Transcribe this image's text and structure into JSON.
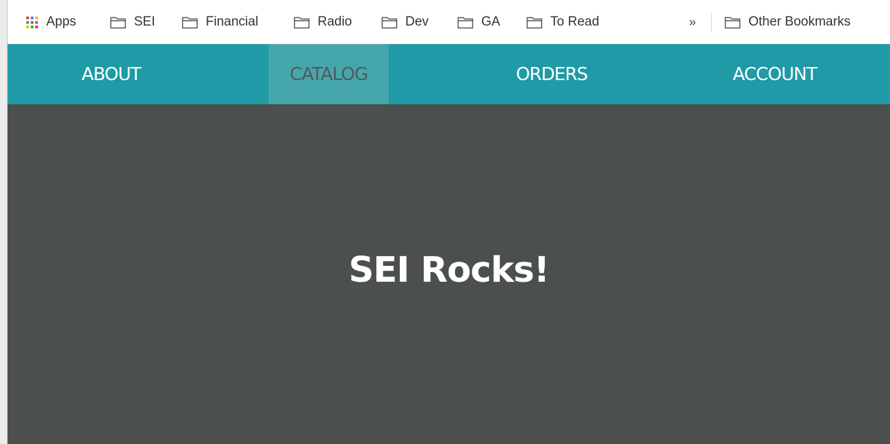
{
  "bookmarks": {
    "apps_label": "Apps",
    "items": [
      {
        "label": "SEI"
      },
      {
        "label": "Financial"
      },
      {
        "label": "Radio"
      },
      {
        "label": "Dev"
      },
      {
        "label": "GA"
      },
      {
        "label": "To Read"
      }
    ],
    "overflow_symbol": "»",
    "other_label": "Other Bookmarks"
  },
  "nav": {
    "items": [
      {
        "label": "ABOUT"
      },
      {
        "label": "CATALOG",
        "active": true
      },
      {
        "label": "ORDERS"
      },
      {
        "label": "ACCOUNT"
      }
    ]
  },
  "hero": {
    "title": "SEI Rocks!"
  },
  "colors": {
    "nav_bg": "#1f9aa6",
    "nav_active_bg": "#45a7ab",
    "hero_bg": "#4b4f4e"
  },
  "icons": {
    "apps": "apps-grid-icon",
    "folder": "folder-icon",
    "overflow": "chevron-double-right-icon"
  }
}
